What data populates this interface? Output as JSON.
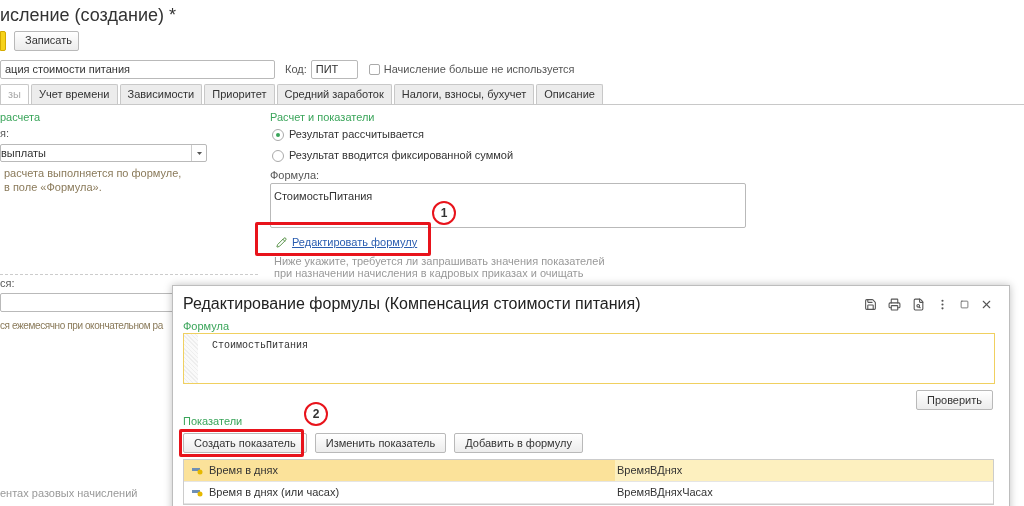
{
  "window": {
    "title": "исление (создание) *"
  },
  "toolbar": {
    "buttons": [
      "Записать"
    ]
  },
  "header": {
    "name_value": "ация стоимости питания",
    "code_label": "Код:",
    "code_value": "ПИТ",
    "unused": {
      "label": "Начисление больше не используется",
      "checked": false
    }
  },
  "tabs": [
    {
      "label": "зы",
      "selected": true
    },
    {
      "label": "Учет времени",
      "selected": false
    },
    {
      "label": "Зависимости",
      "selected": false
    },
    {
      "label": "Приоритет",
      "selected": false
    },
    {
      "label": "Средний заработок",
      "selected": false
    },
    {
      "label": "Налоги, взносы, бухучет",
      "selected": false
    },
    {
      "label": "Описание",
      "selected": false
    }
  ],
  "left": {
    "section": "расчета",
    "field_label": "я:",
    "select_value": "выплаты",
    "hint": [
      "расчета выполняется по формуле,",
      "в поле «Формула»."
    ],
    "field2_label": "ся:",
    "hint2": "ся ежемесячно при окончательном ра",
    "footer_text": "ентах разовых начислений"
  },
  "right": {
    "section": "Расчет и показатели",
    "radios": [
      {
        "label": "Результат рассчитывается",
        "selected": true
      },
      {
        "label": "Результат вводится фиксированной суммой",
        "selected": false
      }
    ],
    "formula_label": "Формула:",
    "formula": "СтоимостьПитания",
    "edit_link": "Редактировать формулу",
    "note": [
      "Ниже укажите, требуется ли запрашивать значения показателей",
      "при назначении начисления в кадровых приказах и очищать"
    ]
  },
  "annotations": [
    "1",
    "2"
  ],
  "dialog": {
    "title": "Редактирование формулы (Компенсация стоимости питания)",
    "formula_label": "Формула",
    "formula": "СтоимостьПитания",
    "check_button": "Проверить",
    "indicators_label": "Показатели",
    "buttons": [
      "Создать показатель",
      "Изменить показатель",
      "Добавить в формулу"
    ],
    "rows": [
      {
        "name": "Время в днях",
        "id": "ВремяВДнях",
        "selected": true
      },
      {
        "name": "Время в днях (или часах)",
        "id": "ВремяВДняхЧасах",
        "selected": false
      }
    ]
  }
}
